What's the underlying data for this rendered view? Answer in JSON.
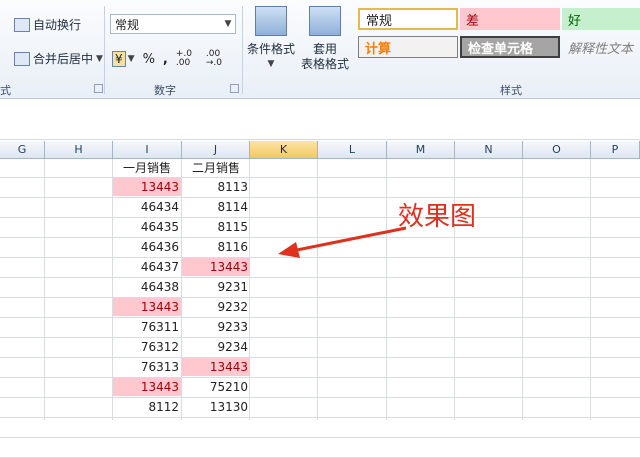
{
  "ribbon": {
    "align_group": {
      "wrap_text": "自动换行",
      "merge_center": "合并后居中",
      "group_label_fragment": "式"
    },
    "number_group": {
      "format_value": "常规",
      "currency_symbol": "¥",
      "percent": "%",
      "comma": ",",
      "increase_decimal": "+.0 .00",
      "decrease_decimal": ".00 →.0",
      "group_label": "数字"
    },
    "conditional_format_label": "条件格式",
    "table_format_label_1": "套用",
    "table_format_label_2": "表格格式",
    "styles": {
      "group_label": "样式",
      "normal": "常规",
      "bad": "差",
      "good": "好",
      "calculation": "计算",
      "check_cell": "检查单元格",
      "explanatory": "解释性文本",
      "colors": {
        "bad_bg": "#ffc7ce",
        "good_bg": "#c6efce",
        "calc_text": "#fa7d00",
        "check_bg": "#a5a5a5"
      }
    }
  },
  "grid": {
    "columns": [
      "G",
      "H",
      "I",
      "J",
      "K",
      "L",
      "M",
      "N",
      "O",
      "P"
    ],
    "selected_column": "K",
    "header_row": [
      "一月销售",
      "二月销售"
    ],
    "rows": [
      {
        "i": "13443",
        "j": "8113",
        "i_red": true,
        "j_red": false
      },
      {
        "i": "46434",
        "j": "8114",
        "i_red": false,
        "j_red": false
      },
      {
        "i": "46435",
        "j": "8115",
        "i_red": false,
        "j_red": false
      },
      {
        "i": "46436",
        "j": "8116",
        "i_red": false,
        "j_red": false
      },
      {
        "i": "46437",
        "j": "13443",
        "i_red": false,
        "j_red": true
      },
      {
        "i": "46438",
        "j": "9231",
        "i_red": false,
        "j_red": false
      },
      {
        "i": "13443",
        "j": "9232",
        "i_red": true,
        "j_red": false
      },
      {
        "i": "76311",
        "j": "9233",
        "i_red": false,
        "j_red": false
      },
      {
        "i": "76312",
        "j": "9234",
        "i_red": false,
        "j_red": false
      },
      {
        "i": "76313",
        "j": "13443",
        "i_red": false,
        "j_red": true
      },
      {
        "i": "13443",
        "j": "75210",
        "i_red": true,
        "j_red": false
      },
      {
        "i": "8112",
        "j": "13130",
        "i_red": false,
        "j_red": false
      }
    ],
    "highlight_colors": {
      "bg": "#ffc7ce",
      "text": "#9c0006"
    }
  },
  "annotation": {
    "text": "效果图",
    "color": "#e0301e"
  }
}
